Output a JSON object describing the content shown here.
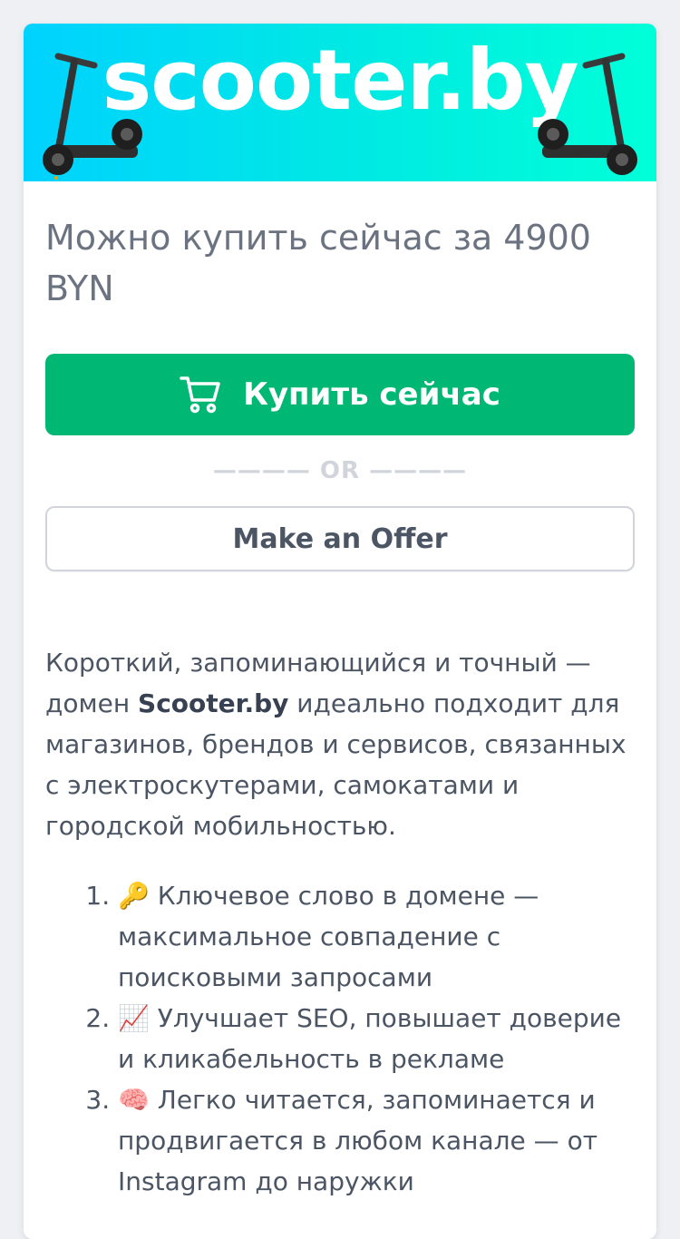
{
  "banner": {
    "brand": "scooter.by",
    "gradient_start": "#00d2ff",
    "gradient_end": "#00ffd8",
    "scooter_icon": "scooter-image"
  },
  "price": {
    "text": "Можно купить сейчас за 4900 BYN"
  },
  "buy": {
    "label": "Купить сейчас",
    "icon": "cart-icon",
    "color": "#00b874"
  },
  "separator": {
    "text": "———— OR ————"
  },
  "offer": {
    "label": "Make an Offer"
  },
  "description": {
    "prefix": "Короткий, запоминающийся и точный — домен ",
    "domain": "Scooter.by",
    "suffix": " идеально подходит для магазинов, брендов и сервисов, связанных с электроскутерами, самокатами и городской мобильностью."
  },
  "features": [
    {
      "emoji": "🔑",
      "text": "Ключевое слово в домене — максимальное совпадение с поисковыми запросами"
    },
    {
      "emoji": "📈",
      "text": "Улучшает SEO, повышает доверие и кликабельность в рекламе"
    },
    {
      "emoji": "🧠",
      "text": "Легко читается, запоминается и продвигается в любом канале — от Instagram до наружки"
    }
  ]
}
